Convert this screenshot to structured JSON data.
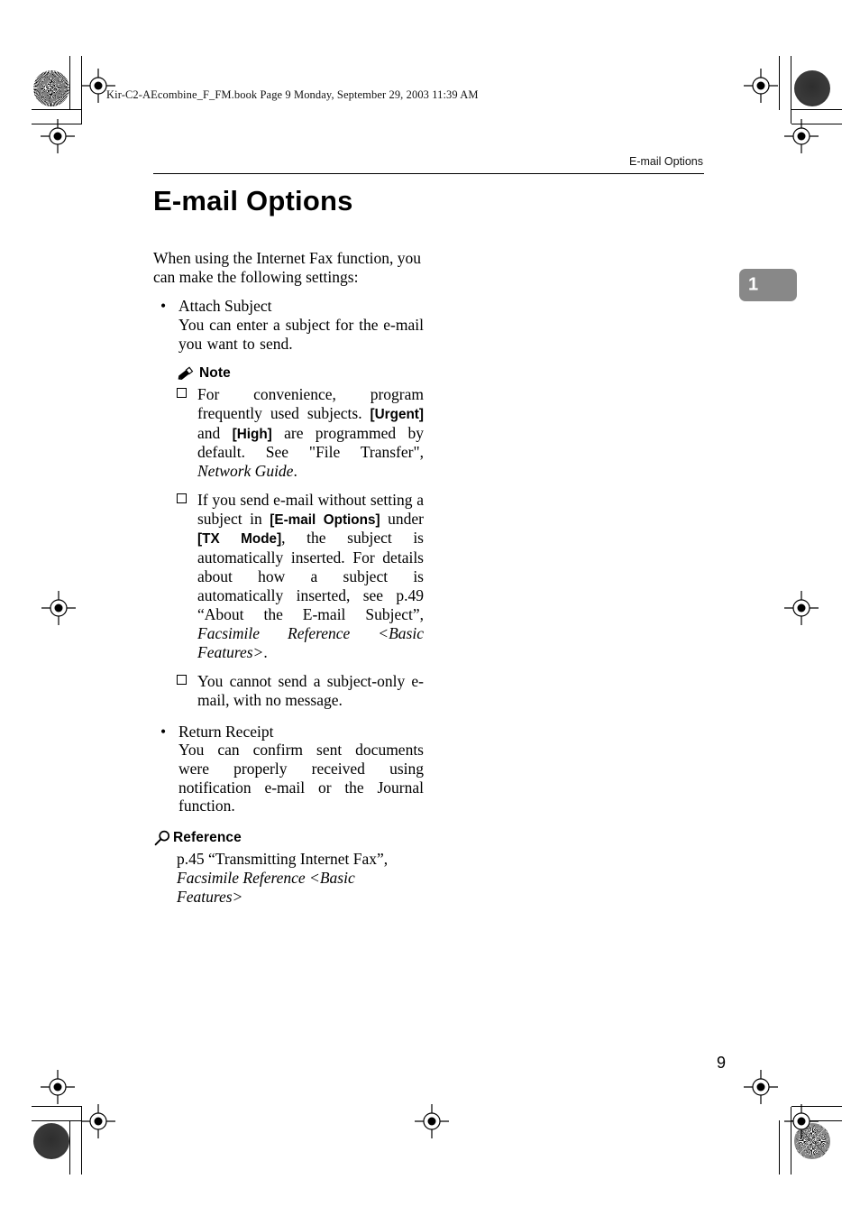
{
  "document": {
    "file_line": "Kir-C2-AEcombine_F_FM.book  Page 9  Monday, September 29, 2003  11:39 AM",
    "running_head": "E-mail Options",
    "chapter_tab": "1",
    "folio": "9"
  },
  "title": "E-mail Options",
  "lead": "When using the Internet Fax function, you can make the following settings:",
  "sections": [
    {
      "bullet": "•",
      "heading": "Attach Subject",
      "body": "You can enter a subject for the e-mail you want to send.",
      "note": {
        "icon": "pencil-icon",
        "label": "Note",
        "items": [
          {
            "parts": [
              {
                "type": "text",
                "text": "For convenience, program frequently used subjects. "
              },
              {
                "type": "key",
                "text": "[Urgent]"
              },
              {
                "type": "text",
                "text": " and "
              },
              {
                "type": "key",
                "text": "[High]"
              },
              {
                "type": "text",
                "text": " are programmed by default. See \"File Transfer\", "
              },
              {
                "type": "italic",
                "text": "Network Guide"
              },
              {
                "type": "text",
                "text": "."
              }
            ]
          },
          {
            "parts": [
              {
                "type": "text",
                "text": "If you send e-mail without setting a subject in "
              },
              {
                "type": "key",
                "text": "[E-mail Options]"
              },
              {
                "type": "text",
                "text": " under "
              },
              {
                "type": "key",
                "text": "[TX Mode]"
              },
              {
                "type": "text",
                "text": ", the subject is automatically inserted. For details about how a subject is automatically inserted, see p.49 “About the E-mail Subject”, "
              },
              {
                "type": "italic",
                "text": "Facsimile Reference <Basic Features>"
              },
              {
                "type": "text",
                "text": "."
              }
            ]
          },
          {
            "parts": [
              {
                "type": "text",
                "text": "You cannot send a subject-only e-mail, with no message."
              }
            ]
          }
        ]
      }
    },
    {
      "bullet": "•",
      "heading": "Return Receipt",
      "body": "You can confirm sent documents were properly received using notification e-mail or the Journal function."
    }
  ],
  "reference": {
    "icon": "magnifier-icon",
    "label": "Reference",
    "line1": "p.45 “Transmitting Internet Fax”,",
    "line2": "Facsimile Reference <Basic Features>"
  },
  "colors": {
    "text": "#000000",
    "chapter_tab_bg": "#888888",
    "chapter_tab_fg": "#ffffff"
  }
}
